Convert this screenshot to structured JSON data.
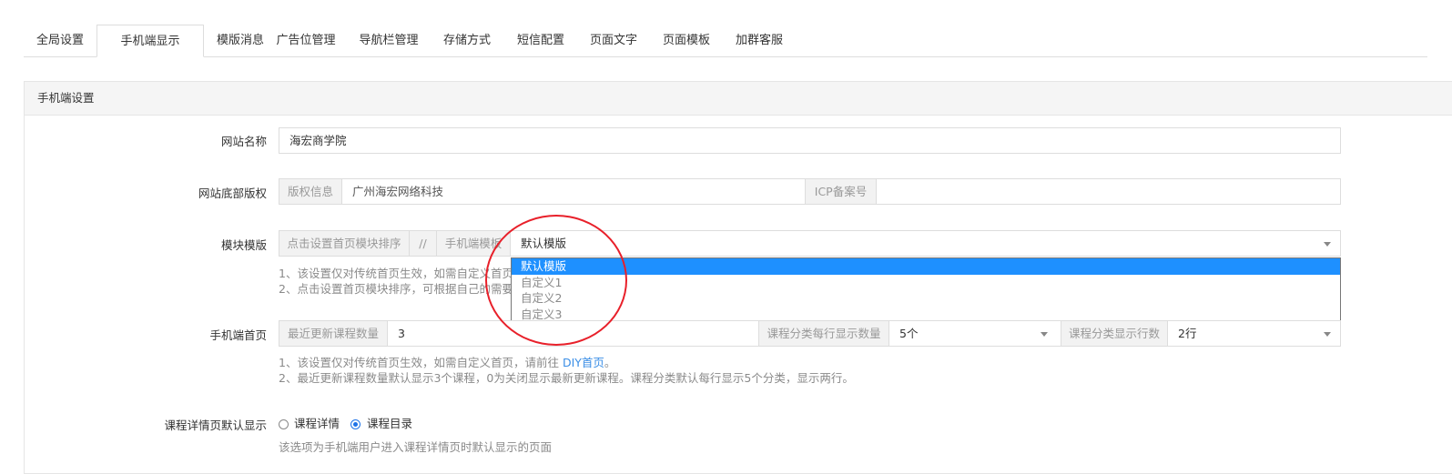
{
  "tabs": [
    {
      "label": "全局设置"
    },
    {
      "label": "手机端显示"
    },
    {
      "label": "模版消息"
    },
    {
      "label": "广告位管理"
    },
    {
      "label": "导航栏管理"
    },
    {
      "label": "存储方式"
    },
    {
      "label": "短信配置"
    },
    {
      "label": "页面文字"
    },
    {
      "label": "页面模板"
    },
    {
      "label": "加群客服"
    }
  ],
  "panel": {
    "heading": "手机端设置"
  },
  "site_name": {
    "label": "网站名称",
    "value": "海宏商学院"
  },
  "copyright": {
    "label": "网站底部版权",
    "addon1": "版权信息",
    "value1": "广州海宏网络科技",
    "addon2": "ICP备案号",
    "value2": ""
  },
  "module": {
    "label": "模块模版",
    "addon1": "点击设置首页模块排序",
    "separator": "//",
    "addon2": "手机端模板",
    "selected": "默认模版",
    "help1": "1、该设置仅对传统首页生效，如需自定义首页",
    "help2": "2、点击设置首页模块排序，可根据自己的需要",
    "options": [
      "默认模版",
      "自定义1",
      "自定义2",
      "自定义3"
    ]
  },
  "home": {
    "label": "手机端首页",
    "addon1": "最近更新课程数量",
    "value1": "3",
    "addon2": "课程分类每行显示数量",
    "value2": "5个",
    "addon3": "课程分类显示行数",
    "value3": "2行",
    "help1_prefix": "1、该设置仅对传统首页生效，如需自定义首页，请前往 ",
    "help1_link": "DIY首页",
    "help1_suffix": "。",
    "help2": "2、最近更新课程数量默认显示3个课程，0为关闭显示最新更新课程。课程分类默认每行显示5个分类，显示两行。"
  },
  "course_detail": {
    "label": "课程详情页默认显示",
    "option1": "课程详情",
    "option2": "课程目录",
    "checked": "课程目录",
    "help": "该选项为手机端用户进入课程详情页时默认显示的页面"
  },
  "annotation": {
    "color": "#e8202a"
  }
}
